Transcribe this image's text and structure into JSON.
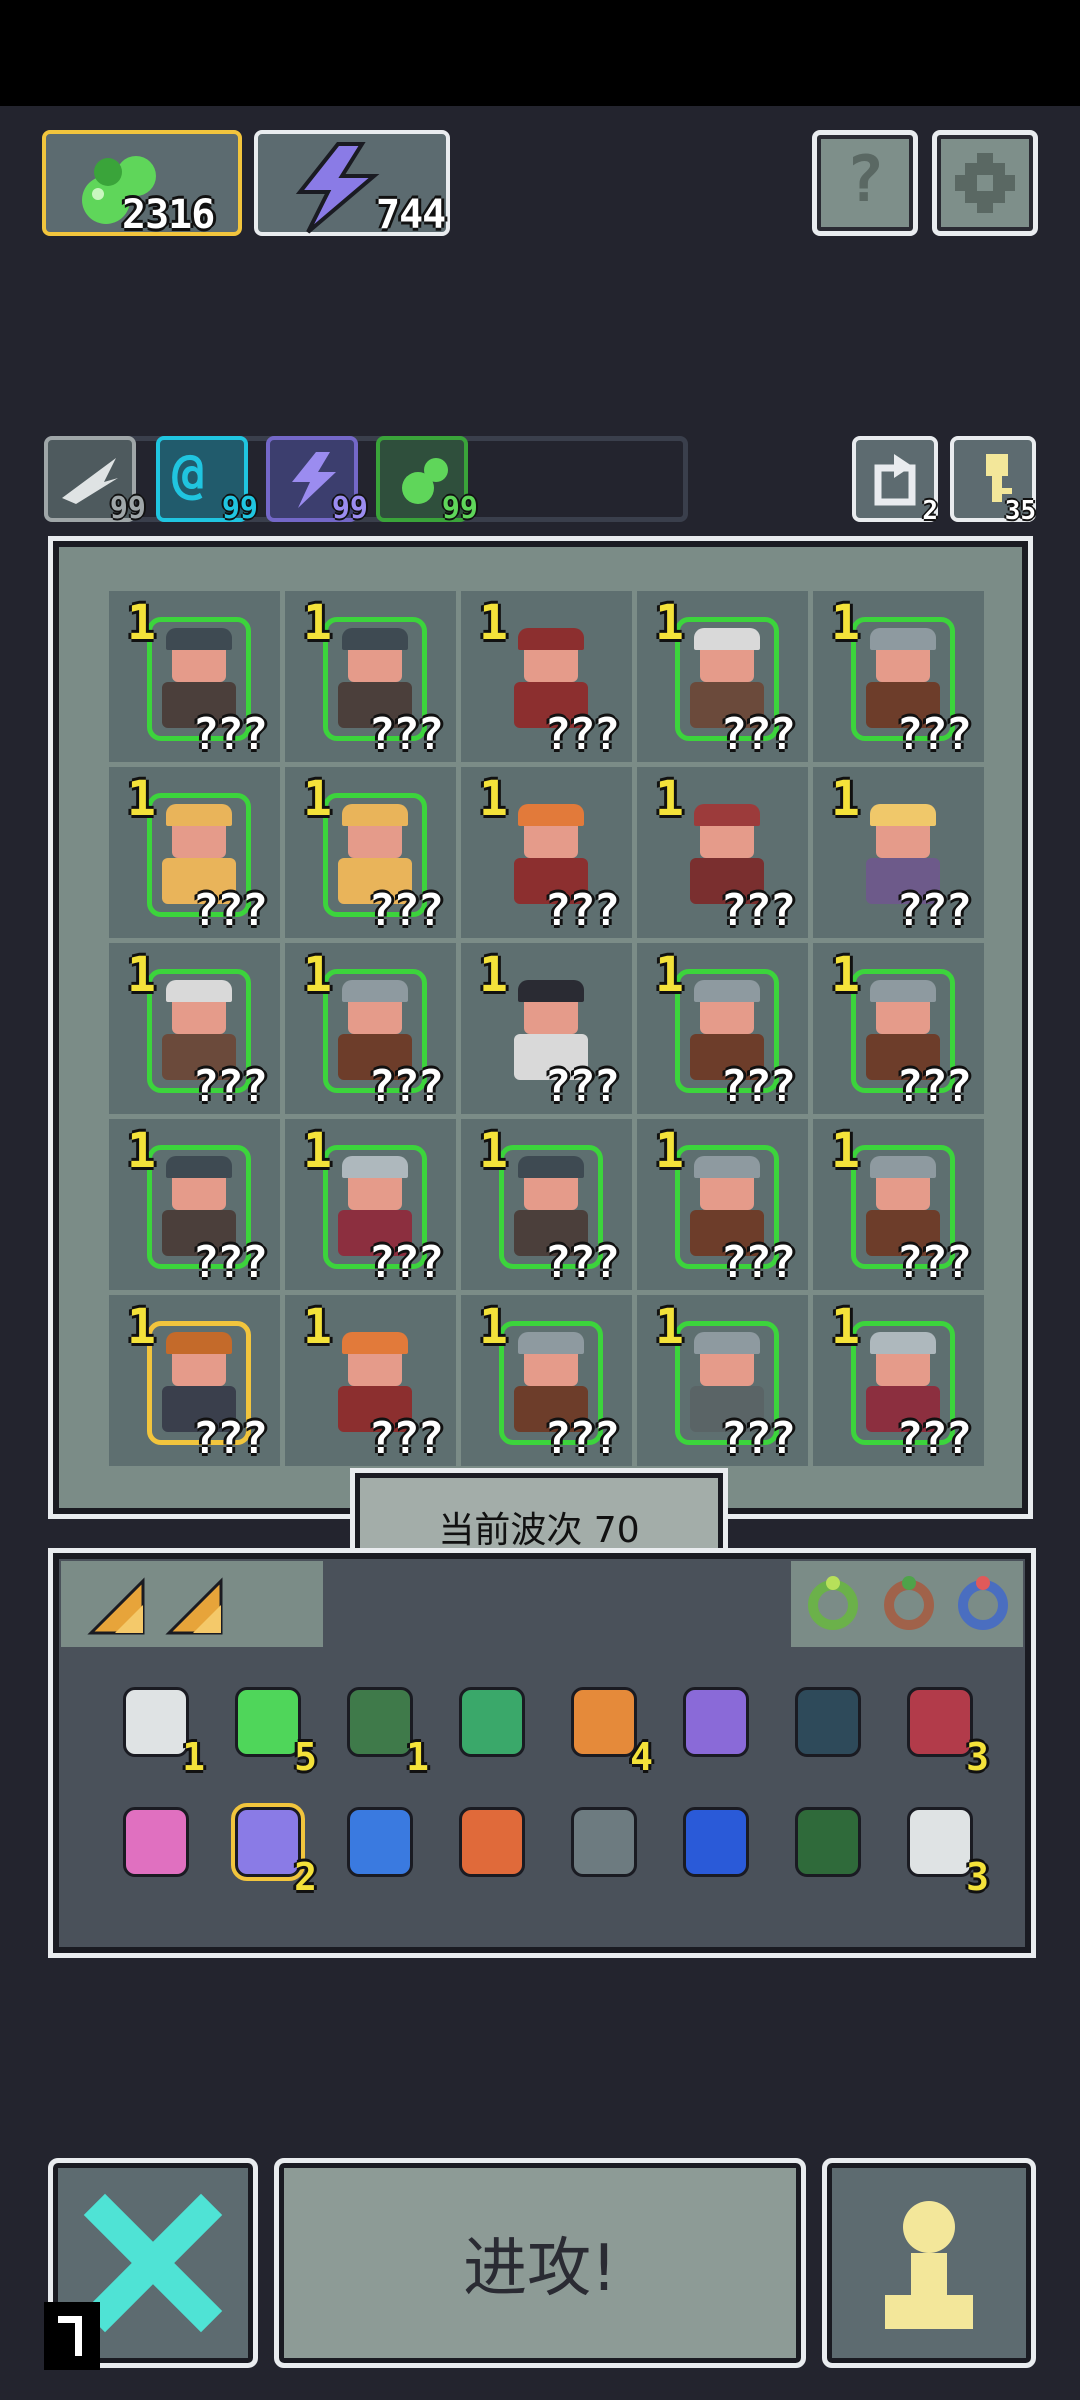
{
  "resources": {
    "gold": {
      "icon": "green-gem-icon",
      "value": "2316"
    },
    "energy": {
      "icon": "lightning-icon",
      "value": "744"
    }
  },
  "top_buttons": [
    {
      "icon": "help-icon",
      "label": "?"
    },
    {
      "icon": "settings-gear-icon"
    }
  ],
  "stats": [
    {
      "icon": "wing-icon",
      "value": "99",
      "color": "#9fa6a8"
    },
    {
      "icon": "at-spiral-icon",
      "value": "99",
      "color": "#20c5e0"
    },
    {
      "icon": "lightning-icon",
      "value": "99",
      "color": "#9b8cf0"
    },
    {
      "icon": "green-gem-icon",
      "value": "99",
      "color": "#5fd65a"
    }
  ],
  "side_counters": [
    {
      "icon": "refresh-icon",
      "value": "2"
    },
    {
      "icon": "key-icon",
      "value": "35"
    }
  ],
  "board": {
    "cells": [
      {
        "level": "1",
        "name": "???",
        "hero": "dwarf-warrior",
        "border": "green"
      },
      {
        "level": "1",
        "name": "???",
        "hero": "dwarf-warrior",
        "border": "green"
      },
      {
        "level": "1",
        "name": "???",
        "hero": "red-hat-mage",
        "border": "none"
      },
      {
        "level": "1",
        "name": "???",
        "hero": "old-wizard",
        "border": "green"
      },
      {
        "level": "1",
        "name": "???",
        "hero": "shield-knight",
        "border": "green"
      },
      {
        "level": "1",
        "name": "???",
        "hero": "golden-golem",
        "border": "green"
      },
      {
        "level": "1",
        "name": "???",
        "hero": "golden-golem",
        "border": "green"
      },
      {
        "level": "1",
        "name": "???",
        "hero": "crowned-king",
        "border": "none"
      },
      {
        "level": "1",
        "name": "???",
        "hero": "bandit-gunner",
        "border": "none"
      },
      {
        "level": "1",
        "name": "???",
        "hero": "blonde-fighter",
        "border": "none"
      },
      {
        "level": "1",
        "name": "???",
        "hero": "old-wizard",
        "border": "green"
      },
      {
        "level": "1",
        "name": "???",
        "hero": "shield-knight",
        "border": "green"
      },
      {
        "level": "1",
        "name": "???",
        "hero": "black-hat-swordsman",
        "border": "none"
      },
      {
        "level": "1",
        "name": "???",
        "hero": "shield-knight",
        "border": "green"
      },
      {
        "level": "1",
        "name": "???",
        "hero": "shield-knight",
        "border": "green"
      },
      {
        "level": "1",
        "name": "???",
        "hero": "dwarf-warrior",
        "border": "green"
      },
      {
        "level": "1",
        "name": "???",
        "hero": "silver-hair-girl",
        "border": "green"
      },
      {
        "level": "1",
        "name": "???",
        "hero": "dwarf-warrior",
        "border": "green"
      },
      {
        "level": "1",
        "name": "???",
        "hero": "shield-knight",
        "border": "green"
      },
      {
        "level": "1",
        "name": "???",
        "hero": "shield-knight",
        "border": "green"
      },
      {
        "level": "1",
        "name": "???",
        "hero": "viking-chief",
        "border": "gold"
      },
      {
        "level": "1",
        "name": "???",
        "hero": "crowned-king",
        "border": "none"
      },
      {
        "level": "1",
        "name": "???",
        "hero": "shield-knight",
        "border": "green"
      },
      {
        "level": "1",
        "name": "???",
        "hero": "armored-knight",
        "border": "green"
      },
      {
        "level": "1",
        "name": "???",
        "hero": "silver-hair-girl",
        "border": "green"
      }
    ]
  },
  "wave": {
    "label": "当前波次 70"
  },
  "inventory": {
    "tabs": [
      {
        "icon": "amber-shard-icon"
      },
      {
        "icon": "amber-shard-icon"
      }
    ],
    "rings": [
      {
        "icon": "green-ring-icon"
      },
      {
        "icon": "copper-ring-icon"
      },
      {
        "icon": "blue-ring-icon"
      }
    ],
    "row1": [
      {
        "icon": "scroll-icon",
        "count": "1"
      },
      {
        "icon": "emerald-icon",
        "count": "5"
      },
      {
        "icon": "hood-cloak-icon",
        "count": "1"
      },
      {
        "icon": "arrow-icon",
        "count": ""
      },
      {
        "icon": "horn-icon",
        "count": "4"
      },
      {
        "icon": "purple-axe-icon",
        "count": ""
      },
      {
        "icon": "bell-icon",
        "count": ""
      },
      {
        "icon": "red-cloak-icon",
        "count": "3"
      }
    ],
    "row2": [
      {
        "icon": "pink-arrow-icon",
        "count": ""
      },
      {
        "icon": "potion-jar-icon",
        "count": "2"
      },
      {
        "icon": "water-drop-icon",
        "count": ""
      },
      {
        "icon": "fire-arrow-icon",
        "count": ""
      },
      {
        "icon": "shuriken-icon",
        "count": ""
      },
      {
        "icon": "blue-flame-tile-icon",
        "count": ""
      },
      {
        "icon": "green-rune-tile-icon",
        "count": ""
      },
      {
        "icon": "crossed-axes-icon",
        "count": "3"
      }
    ]
  },
  "bottom": {
    "cancel": {
      "icon": "close-x-icon"
    },
    "attack": {
      "label": "进攻!"
    },
    "hero": {
      "icon": "pawn-icon"
    }
  },
  "colors": {
    "background": "#23242e",
    "panel": "#7b8c87",
    "gold": "#f2c53d",
    "level": "#f4e23a",
    "hero_border": "#3cd43c",
    "x_cyan": "#4fe3d5",
    "pawn_yellow": "#f3e79a"
  }
}
